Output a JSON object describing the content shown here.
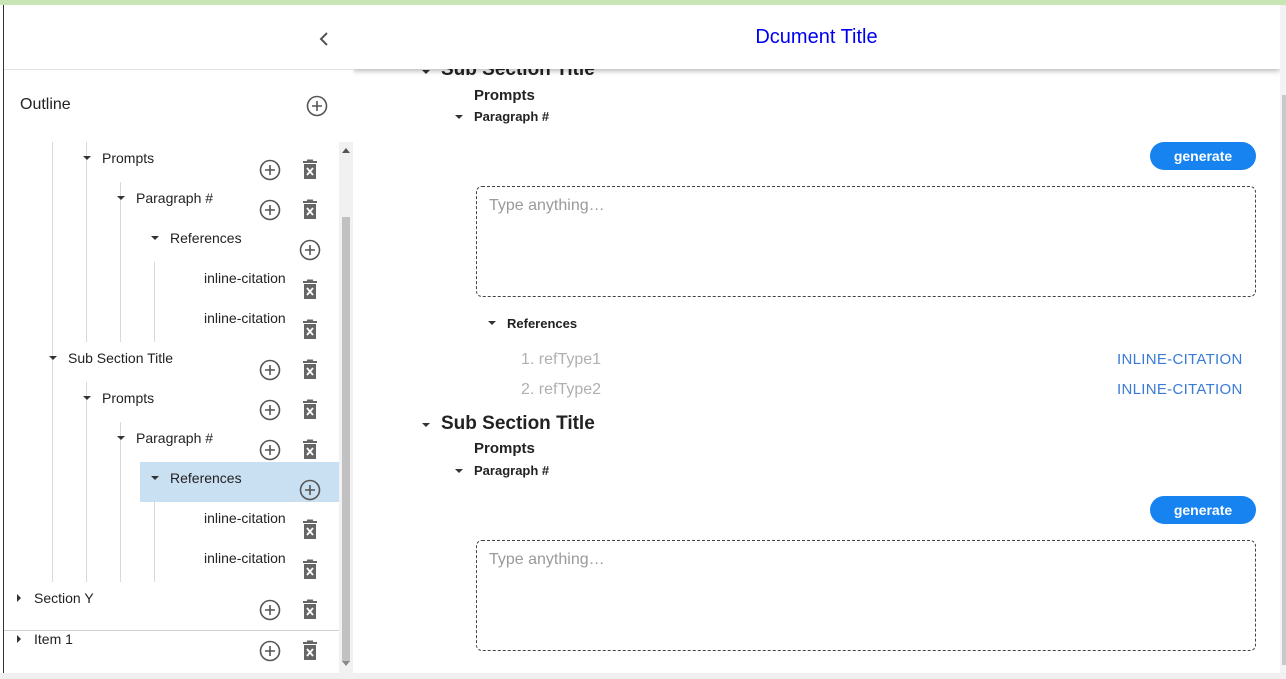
{
  "document": {
    "title": "Dcument Title"
  },
  "sidebar": {
    "title": "Outline",
    "tree": [
      {
        "label": "Prompts",
        "expanded": true,
        "add": true,
        "del": true
      },
      {
        "label": "Paragraph #",
        "expanded": true,
        "add": true,
        "del": true
      },
      {
        "label": "References",
        "expanded": true,
        "add": true,
        "del": false
      },
      {
        "label": "inline-citation",
        "add": false,
        "del": true
      },
      {
        "label": "inline-citation",
        "add": false,
        "del": true
      },
      {
        "label": "Sub Section Title",
        "expanded": true,
        "add": true,
        "del": true
      },
      {
        "label": "Prompts",
        "expanded": true,
        "add": true,
        "del": true
      },
      {
        "label": "Paragraph #",
        "expanded": true,
        "add": true,
        "del": true
      },
      {
        "label": "References",
        "expanded": true,
        "selected": true,
        "add": true,
        "del": false
      },
      {
        "label": "inline-citation",
        "add": false,
        "del": true
      },
      {
        "label": "inline-citation",
        "add": false,
        "del": true
      },
      {
        "label": "Section Y",
        "expanded": false,
        "add": true,
        "del": true
      },
      {
        "label": "Item 1",
        "expanded": false,
        "add": true,
        "del": true
      }
    ]
  },
  "main": {
    "sections": [
      {
        "title": "Sub Section Title",
        "prompts_label": "Prompts",
        "paragraph_label": "Paragraph #",
        "generate_label": "generate",
        "placeholder": "Type anything…",
        "references_label": "References",
        "references": [
          {
            "text": "1. refType1",
            "link": "INLINE-CITATION"
          },
          {
            "text": "2. refType2",
            "link": "INLINE-CITATION"
          }
        ]
      },
      {
        "title": "Sub Section Title",
        "prompts_label": "Prompts",
        "paragraph_label": "Paragraph #",
        "generate_label": "generate",
        "placeholder": "Type anything…"
      }
    ]
  },
  "colors": {
    "accent": "#1683f0",
    "link": "#3a7bd5",
    "title": "#0000ee",
    "selection": "#c9dff2"
  }
}
